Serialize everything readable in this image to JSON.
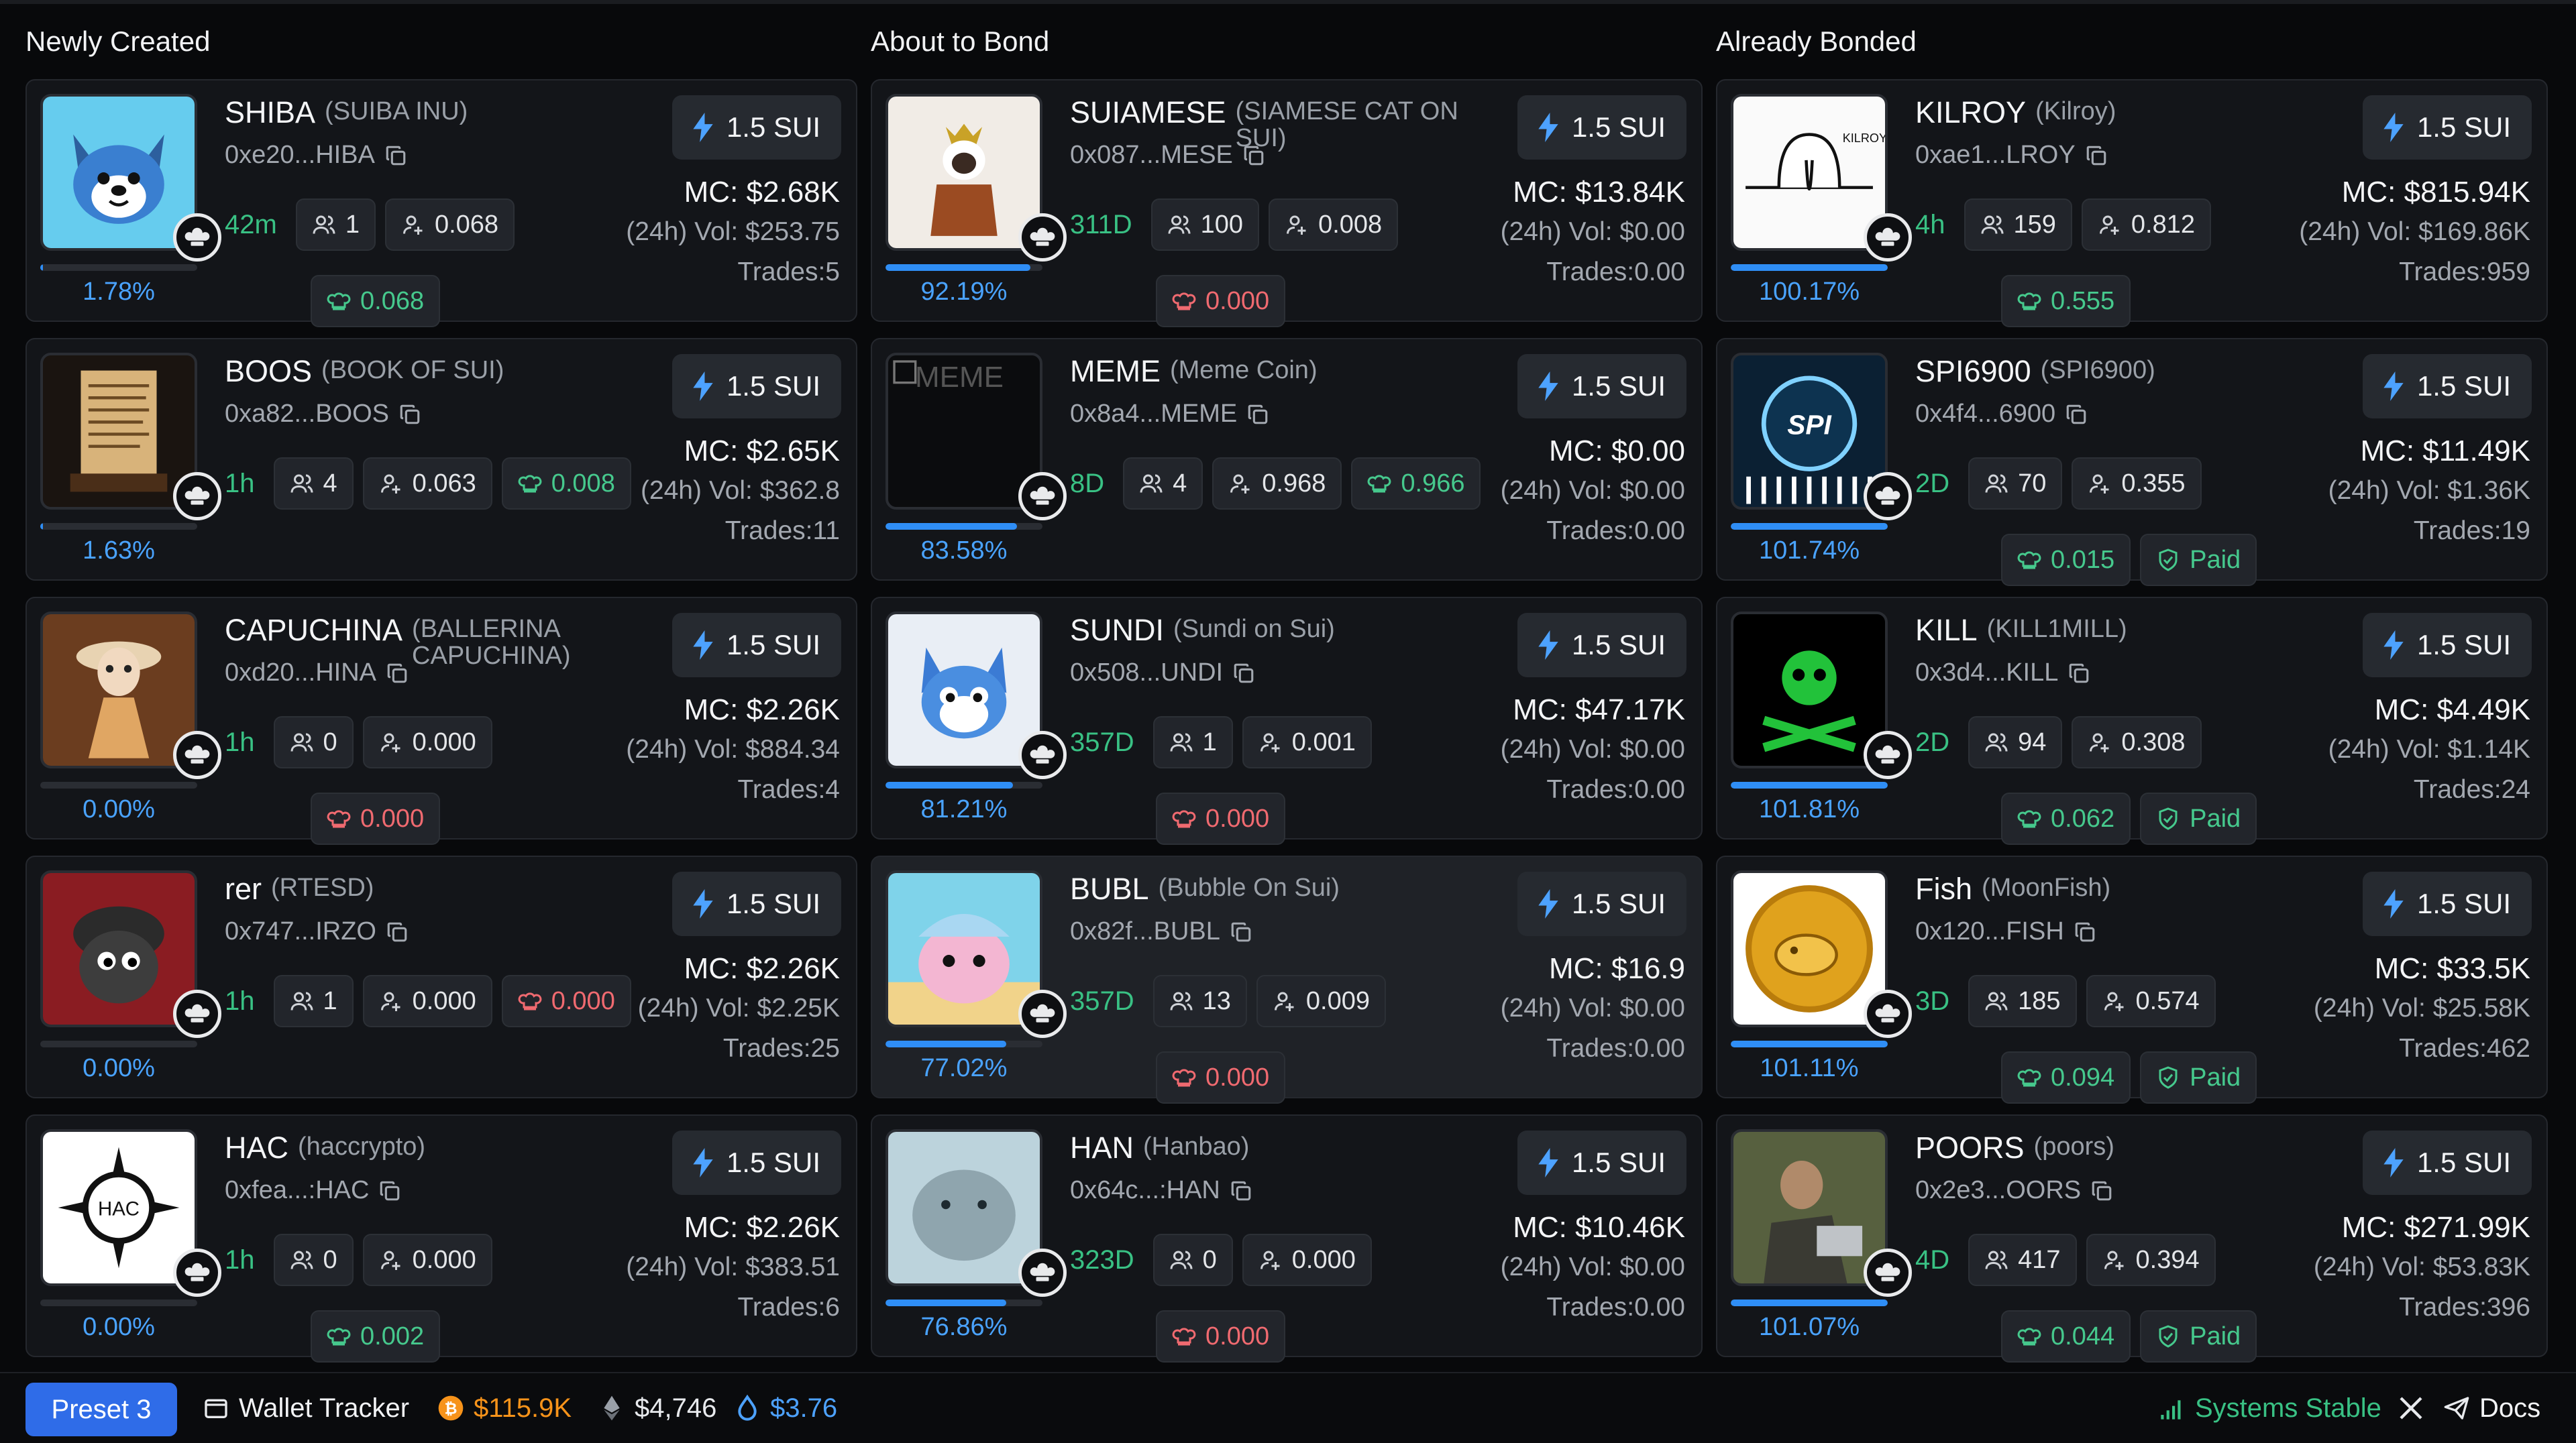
{
  "columns": [
    {
      "title": "Newly Created",
      "cards": [
        {
          "symbol": "SHIBA",
          "fullname": "(SUIBA INU)",
          "addr": "0xe20...HIBA",
          "age": "42m",
          "holders": "1",
          "buyers": "0.068",
          "extra_chip": {
            "kind": "green",
            "text": "0.068"
          },
          "paid": false,
          "mc": "MC: $2.68K",
          "vol": "(24h) Vol: $253.75",
          "trades": "Trades:5",
          "sui": "1.5 SUI",
          "pct": "1.78%",
          "progress": 0.0178,
          "avatar": "shiba",
          "highlight": false
        },
        {
          "symbol": "BOOS",
          "fullname": "(BOOK OF SUI)",
          "addr": "0xa82...BOOS",
          "age": "1h",
          "holders": "4",
          "buyers": "0.063",
          "extra_chip": {
            "kind": "green",
            "text": "0.008"
          },
          "inline_extra": true,
          "paid": false,
          "mc": "MC: $2.65K",
          "vol": "(24h) Vol: $362.8",
          "trades": "Trades:11",
          "sui": "1.5 SUI",
          "pct": "1.63%",
          "progress": 0.0163,
          "avatar": "book",
          "highlight": false
        },
        {
          "symbol": "CAPUCHINA",
          "fullname": "(BALLERINA CAPUCHINA)",
          "addr": "0xd20...HINA",
          "age": "1h",
          "holders": "0",
          "buyers": "0.000",
          "extra_chip": {
            "kind": "red",
            "text": "0.000"
          },
          "paid": false,
          "mc": "MC: $2.26K",
          "vol": "(24h) Vol: $884.34",
          "trades": "Trades:4",
          "sui": "1.5 SUI",
          "pct": "0.00%",
          "progress": 0,
          "avatar": "capuchina",
          "highlight": false
        },
        {
          "symbol": "rer",
          "fullname": "(RTESD)",
          "addr": "0x747...IRZO",
          "age": "1h",
          "holders": "1",
          "buyers": "0.000",
          "extra_chip": {
            "kind": "red",
            "text": "0.000"
          },
          "inline_extra": true,
          "paid": false,
          "mc": "MC: $2.26K",
          "vol": "(24h) Vol: $2.25K",
          "trades": "Trades:25",
          "sui": "1.5 SUI",
          "pct": "0.00%",
          "progress": 0,
          "avatar": "rer",
          "highlight": false
        },
        {
          "symbol": "HAC",
          "fullname": "(haccrypto)",
          "addr": "0xfea...:HAC",
          "age": "1h",
          "holders": "0",
          "buyers": "0.000",
          "extra_chip": {
            "kind": "green",
            "text": "0.002"
          },
          "paid": false,
          "mc": "MC: $2.26K",
          "vol": "(24h) Vol: $383.51",
          "trades": "Trades:6",
          "sui": "1.5 SUI",
          "pct": "0.00%",
          "progress": 0,
          "avatar": "hac",
          "highlight": false
        }
      ]
    },
    {
      "title": "About to Bond",
      "cards": [
        {
          "symbol": "SUIAMESE",
          "fullname": "(SIAMESE CAT ON SUI)",
          "addr": "0x087...MESE",
          "age": "311D",
          "holders": "100",
          "buyers": "0.008",
          "extra_chip": {
            "kind": "red",
            "text": "0.000"
          },
          "paid": false,
          "mc": "MC: $13.84K",
          "vol": "(24h) Vol: $0.00",
          "trades": "Trades:0.00",
          "sui": "1.5 SUI",
          "pct": "92.19%",
          "progress": 0.9219,
          "avatar": "cat",
          "highlight": false
        },
        {
          "symbol": "MEME",
          "fullname": "(Meme Coin)",
          "addr": "0x8a4...MEME",
          "age": "8D",
          "holders": "4",
          "buyers": "0.968",
          "extra_chip": {
            "kind": "green",
            "text": "0.966"
          },
          "inline_extra": true,
          "paid": false,
          "mc": "MC: $0.00",
          "vol": "(24h) Vol: $0.00",
          "trades": "Trades:0.00",
          "sui": "1.5 SUI",
          "pct": "83.58%",
          "progress": 0.8358,
          "avatar": "meme",
          "alt": "MEME",
          "highlight": false
        },
        {
          "symbol": "SUNDI",
          "fullname": "(Sundi on Sui)",
          "addr": "0x508...UNDI",
          "age": "357D",
          "holders": "1",
          "buyers": "0.001",
          "extra_chip": {
            "kind": "red",
            "text": "0.000"
          },
          "paid": false,
          "mc": "MC: $47.17K",
          "vol": "(24h) Vol: $0.00",
          "trades": "Trades:0.00",
          "sui": "1.5 SUI",
          "pct": "81.21%",
          "progress": 0.8121,
          "avatar": "fox",
          "highlight": false
        },
        {
          "symbol": "BUBL",
          "fullname": "(Bubble On Sui)",
          "addr": "0x82f...BUBL",
          "age": "357D",
          "holders": "13",
          "buyers": "0.009",
          "extra_chip": {
            "kind": "red",
            "text": "0.000"
          },
          "paid": false,
          "mc": "MC: $16.9",
          "vol": "(24h) Vol: $0.00",
          "trades": "Trades:0.00",
          "sui": "1.5 SUI",
          "pct": "77.02%",
          "progress": 0.7702,
          "avatar": "bubl",
          "highlight": true
        },
        {
          "symbol": "HAN",
          "fullname": "(Hanbao)",
          "addr": "0x64c...:HAN",
          "age": "323D",
          "holders": "0",
          "buyers": "0.000",
          "extra_chip": {
            "kind": "red",
            "text": "0.000"
          },
          "paid": false,
          "mc": "MC: $10.46K",
          "vol": "(24h) Vol: $0.00",
          "trades": "Trades:0.00",
          "sui": "1.5 SUI",
          "pct": "76.86%",
          "progress": 0.7686,
          "avatar": "han",
          "highlight": false
        }
      ]
    },
    {
      "title": "Already Bonded",
      "cards": [
        {
          "symbol": "KILROY",
          "fullname": "(Kilroy)",
          "addr": "0xae1...LROY",
          "age": "4h",
          "holders": "159",
          "buyers": "0.812",
          "extra_chip": {
            "kind": "green",
            "text": "0.555"
          },
          "paid": false,
          "mc": "MC: $815.94K",
          "vol": "(24h) Vol: $169.86K",
          "trades": "Trades:959",
          "sui": "1.5 SUI",
          "pct": "100.17%",
          "progress": 1,
          "avatar": "kilroy",
          "highlight": false
        },
        {
          "symbol": "SPI6900",
          "fullname": "(SPI6900)",
          "addr": "0x4f4...6900",
          "age": "2D",
          "holders": "70",
          "buyers": "0.355",
          "extra_chip": {
            "kind": "green",
            "text": "0.015"
          },
          "paid": true,
          "mc": "MC: $11.49K",
          "vol": "(24h) Vol: $1.36K",
          "trades": "Trades:19",
          "sui": "1.5 SUI",
          "pct": "101.74%",
          "progress": 1,
          "avatar": "spi",
          "highlight": false
        },
        {
          "symbol": "KILL",
          "fullname": "(KILL1MILL)",
          "addr": "0x3d4...KILL",
          "age": "2D",
          "holders": "94",
          "buyers": "0.308",
          "extra_chip": {
            "kind": "green",
            "text": "0.062"
          },
          "paid": true,
          "mc": "MC: $4.49K",
          "vol": "(24h) Vol: $1.14K",
          "trades": "Trades:24",
          "sui": "1.5 SUI",
          "pct": "101.81%",
          "progress": 1,
          "avatar": "kill",
          "highlight": false
        },
        {
          "symbol": "Fish",
          "fullname": "(MoonFish)",
          "addr": "0x120...FISH",
          "age": "3D",
          "holders": "185",
          "buyers": "0.574",
          "extra_chip": {
            "kind": "green",
            "text": "0.094"
          },
          "paid": true,
          "mc": "MC: $33.5K",
          "vol": "(24h) Vol: $25.58K",
          "trades": "Trades:462",
          "sui": "1.5 SUI",
          "pct": "101.11%",
          "progress": 1,
          "avatar": "fish",
          "highlight": false
        },
        {
          "symbol": "POORS",
          "fullname": "(poors)",
          "addr": "0x2e3...OORS",
          "age": "4D",
          "holders": "417",
          "buyers": "0.394",
          "extra_chip": {
            "kind": "green",
            "text": "0.044"
          },
          "paid": true,
          "mc": "MC: $271.99K",
          "vol": "(24h) Vol: $53.83K",
          "trades": "Trades:396",
          "sui": "1.5 SUI",
          "pct": "101.07%",
          "progress": 1,
          "avatar": "poors",
          "highlight": false
        }
      ]
    }
  ],
  "paid_label": "Paid",
  "footer": {
    "preset": "Preset 3",
    "wallet_tracker": "Wallet Tracker",
    "btc": "$115.9K",
    "eth": "$4,746",
    "sui": "$3.76",
    "status": "Systems Stable",
    "docs": "Docs"
  },
  "colors": {
    "accent": "#2f8ef6",
    "green": "#39c184",
    "red": "#f06a70",
    "btc": "#f7931a",
    "sui": "#4da2ff"
  }
}
